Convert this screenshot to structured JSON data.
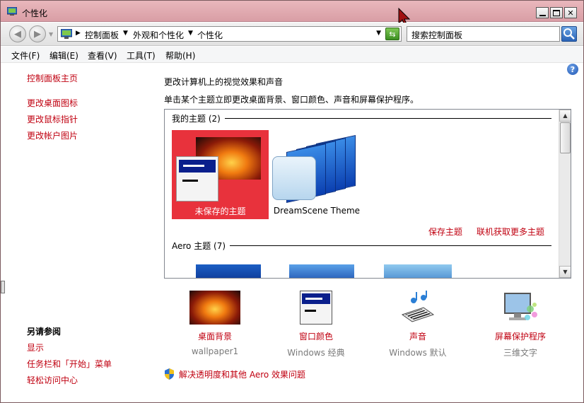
{
  "window": {
    "title": "个性化"
  },
  "address": {
    "crumbs": [
      "控制面板",
      "外观和个性化",
      "个性化"
    ],
    "search_placeholder": "搜索控制面板"
  },
  "menu": [
    "文件(F)",
    "编辑(E)",
    "查看(V)",
    "工具(T)",
    "帮助(H)"
  ],
  "left_pane": {
    "home": "控制面板主页",
    "tasks": [
      "更改桌面图标",
      "更改鼠标指针",
      "更改帐户图片"
    ],
    "see_also_title": "另请参阅",
    "see_also": [
      "显示",
      "任务栏和「开始」菜单",
      "轻松访问中心"
    ]
  },
  "main": {
    "heading": "更改计算机上的视觉效果和声音",
    "description": "单击某个主题立即更改桌面背景、窗口颜色、声音和屏幕保护程序。",
    "my_themes_label": "我的主题 (2)",
    "themes": [
      {
        "name": "未保存的主题",
        "selected": true
      },
      {
        "name": "DreamScene Theme",
        "selected": false
      }
    ],
    "save_theme": "保存主题",
    "get_more": "联机获取更多主题",
    "aero_label": "Aero 主题 (7)"
  },
  "options": [
    {
      "label": "桌面背景",
      "value": "wallpaper1",
      "icon": "wallpaper-icon"
    },
    {
      "label": "窗口颜色",
      "value": "Windows 经典",
      "icon": "window-color-icon"
    },
    {
      "label": "声音",
      "value": "Windows 默认",
      "icon": "sound-icon"
    },
    {
      "label": "屏幕保护程序",
      "value": "三维文字",
      "icon": "screensaver-icon"
    }
  ],
  "aero_fix": "解决透明度和其他 Aero 效果问题",
  "colors": {
    "link": "#c00010",
    "selected_theme": "#e8323c",
    "title_bar": "#dfa8ae"
  }
}
